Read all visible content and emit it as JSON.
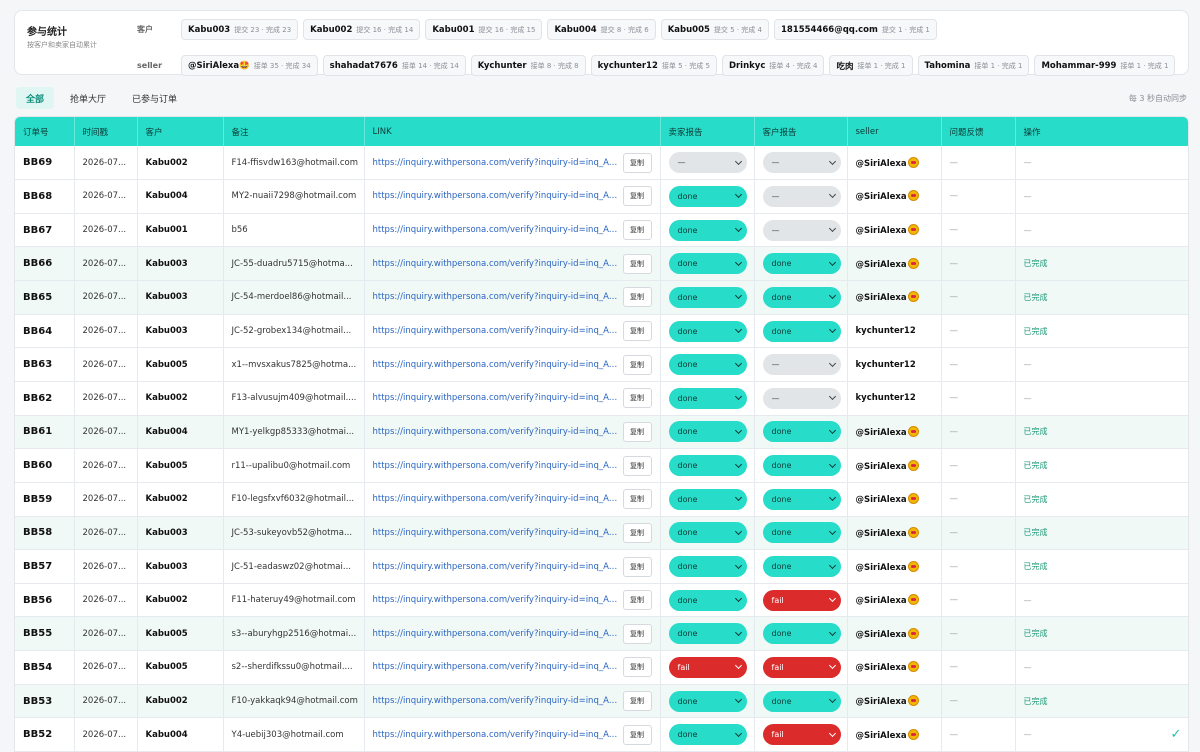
{
  "stats": {
    "title": "参与统计",
    "subtitle": "按客户和卖家自动累计",
    "customer_label": "客户",
    "seller_label": "seller",
    "customers": [
      {
        "name": "Kabu003",
        "meta": "提交 23 · 完成 23"
      },
      {
        "name": "Kabu002",
        "meta": "提交 16 · 完成 14"
      },
      {
        "name": "Kabu001",
        "meta": "提交 16 · 完成 15"
      },
      {
        "name": "Kabu004",
        "meta": "提交 8 · 完成 6"
      },
      {
        "name": "Kabu005",
        "meta": "提交 5 · 完成 4"
      },
      {
        "name": "181554466@qq.com",
        "meta": "提交 1 · 完成 1"
      }
    ],
    "sellers": [
      {
        "name": "@SiriAlexa🤩",
        "meta": "接单 35 · 完成 34"
      },
      {
        "name": "shahadat7676",
        "meta": "接单 14 · 完成 14"
      },
      {
        "name": "Kychunter",
        "meta": "接单 8 · 完成 8"
      },
      {
        "name": "kychunter12",
        "meta": "接单 5 · 完成 5"
      },
      {
        "name": "Drinkyc",
        "meta": "接单 4 · 完成 4"
      },
      {
        "name": "吃肉",
        "meta": "接单 1 · 完成 1"
      },
      {
        "name": "Tahomina",
        "meta": "接单 1 · 完成 1"
      },
      {
        "name": "Mohammar-999",
        "meta": "接单 1 · 完成 1"
      }
    ]
  },
  "tabs": [
    "全部",
    "抢单大厅",
    "已参与订单"
  ],
  "sync_note": "每 3 秒自动同步",
  "table": {
    "headers": [
      "订单号",
      "时间戳",
      "客户",
      "备注",
      "LINK",
      "卖家报告",
      "客户报告",
      "seller",
      "问题反馈",
      "操作"
    ],
    "copy_label": "复制",
    "rows": [
      {
        "order": "BB69",
        "time": "2026-07...",
        "customer": "Kabu002",
        "note": "F14-ffisvdw163@hotmail.com",
        "link": "https://inquiry.withpersona.com/verify?inquiry-id=inq_Aq...",
        "seller_report": "—",
        "customer_report": "—",
        "seller": "@SiriAlexa",
        "feedback": "—",
        "action": "—"
      },
      {
        "order": "BB68",
        "time": "2026-07...",
        "customer": "Kabu004",
        "note": "MY2-nuaii7298@hotmail.com",
        "link": "https://inquiry.withpersona.com/verify?inquiry-id=inq_Aq...",
        "seller_report": "done",
        "customer_report": "—",
        "seller": "@SiriAlexa",
        "feedback": "—",
        "action": "—"
      },
      {
        "order": "BB67",
        "time": "2026-07...",
        "customer": "Kabu001",
        "note": "b56",
        "link": "https://inquiry.withpersona.com/verify?inquiry-id=inq_Aq...",
        "seller_report": "done",
        "customer_report": "—",
        "seller": "@SiriAlexa",
        "feedback": "—",
        "action": "—"
      },
      {
        "order": "BB66",
        "time": "2026-07...",
        "customer": "Kabu003",
        "note": "JC-55-duadru5715@hotma...",
        "link": "https://inquiry.withpersona.com/verify?inquiry-id=inq_Aq...",
        "seller_report": "done",
        "customer_report": "done",
        "seller": "@SiriAlexa",
        "feedback": "—",
        "action": "已完成"
      },
      {
        "order": "BB65",
        "time": "2026-07...",
        "customer": "Kabu003",
        "note": "JC-54-merdoel86@hotmail...",
        "link": "https://inquiry.withpersona.com/verify?inquiry-id=inq_Aq...",
        "seller_report": "done",
        "customer_report": "done",
        "seller": "@SiriAlexa",
        "feedback": "—",
        "action": "已完成"
      },
      {
        "order": "BB64",
        "time": "2026-07...",
        "customer": "Kabu003",
        "note": "JC-52-grobex134@hotmail...",
        "link": "https://inquiry.withpersona.com/verify?inquiry-id=inq_Aq...",
        "seller_report": "done",
        "customer_report": "done",
        "seller": "kychunter12",
        "feedback": "—",
        "action": "已完成"
      },
      {
        "order": "BB63",
        "time": "2026-07...",
        "customer": "Kabu005",
        "note": "x1--mvsxakus7825@hotma...",
        "link": "https://inquiry.withpersona.com/verify?inquiry-id=inq_Aq...",
        "seller_report": "done",
        "customer_report": "—",
        "seller": "kychunter12",
        "feedback": "—",
        "action": "—"
      },
      {
        "order": "BB62",
        "time": "2026-07...",
        "customer": "Kabu002",
        "note": "F13-alvusujm409@hotmail....",
        "link": "https://inquiry.withpersona.com/verify?inquiry-id=inq_Aq...",
        "seller_report": "done",
        "customer_report": "—",
        "seller": "kychunter12",
        "feedback": "—",
        "action": "—"
      },
      {
        "order": "BB61",
        "time": "2026-07...",
        "customer": "Kabu004",
        "note": "MY1-yelkgp85333@hotmai...",
        "link": "https://inquiry.withpersona.com/verify?inquiry-id=inq_Aq...",
        "seller_report": "done",
        "customer_report": "done",
        "seller": "@SiriAlexa",
        "feedback": "—",
        "action": "已完成"
      },
      {
        "order": "BB60",
        "time": "2026-07...",
        "customer": "Kabu005",
        "note": "r11--upalibu0@hotmail.com",
        "link": "https://inquiry.withpersona.com/verify?inquiry-id=inq_Aq...",
        "seller_report": "done",
        "customer_report": "done",
        "seller": "@SiriAlexa",
        "feedback": "—",
        "action": "已完成"
      },
      {
        "order": "BB59",
        "time": "2026-07...",
        "customer": "Kabu002",
        "note": "F10-legsfxvf6032@hotmail...",
        "link": "https://inquiry.withpersona.com/verify?inquiry-id=inq_Aq...",
        "seller_report": "done",
        "customer_report": "done",
        "seller": "@SiriAlexa",
        "feedback": "—",
        "action": "已完成"
      },
      {
        "order": "BB58",
        "time": "2026-07...",
        "customer": "Kabu003",
        "note": "JC-53-sukeyovb52@hotma...",
        "link": "https://inquiry.withpersona.com/verify?inquiry-id=inq_Aq...",
        "seller_report": "done",
        "customer_report": "done",
        "seller": "@SiriAlexa",
        "feedback": "—",
        "action": "已完成"
      },
      {
        "order": "BB57",
        "time": "2026-07...",
        "customer": "Kabu003",
        "note": "JC-51-eadaswz02@hotmai...",
        "link": "https://inquiry.withpersona.com/verify?inquiry-id=inq_Aq...",
        "seller_report": "done",
        "customer_report": "done",
        "seller": "@SiriAlexa",
        "feedback": "—",
        "action": "已完成"
      },
      {
        "order": "BB56",
        "time": "2026-07...",
        "customer": "Kabu002",
        "note": "F11-hateruy49@hotmail.com",
        "link": "https://inquiry.withpersona.com/verify?inquiry-id=inq_Aq...",
        "seller_report": "done",
        "customer_report": "fail",
        "seller": "@SiriAlexa",
        "feedback": "—",
        "action": "—"
      },
      {
        "order": "BB55",
        "time": "2026-07...",
        "customer": "Kabu005",
        "note": "s3--aburyhgp2516@hotmai...",
        "link": "https://inquiry.withpersona.com/verify?inquiry-id=inq_Aq...",
        "seller_report": "done",
        "customer_report": "done",
        "seller": "@SiriAlexa",
        "feedback": "—",
        "action": "已完成"
      },
      {
        "order": "BB54",
        "time": "2026-07...",
        "customer": "Kabu005",
        "note": "s2--sherdifkssu0@hotmail....",
        "link": "https://inquiry.withpersona.com/verify?inquiry-id=inq_Aq...",
        "seller_report": "fail",
        "customer_report": "fail",
        "seller": "@SiriAlexa",
        "feedback": "—",
        "action": "—"
      },
      {
        "order": "BB53",
        "time": "2026-07...",
        "customer": "Kabu002",
        "note": "F10-yakkaqk94@hotmail.com",
        "link": "https://inquiry.withpersona.com/verify?inquiry-id=inq_Aq...",
        "seller_report": "done",
        "customer_report": "done",
        "seller": "@SiriAlexa",
        "feedback": "—",
        "action": "已完成"
      },
      {
        "order": "BB52",
        "time": "2026-07...",
        "customer": "Kabu004",
        "note": "Y4-uebij303@hotmail.com",
        "link": "https://inquiry.withpersona.com/verify?inquiry-id=inq_Aq...",
        "seller_report": "done",
        "customer_report": "fail",
        "seller": "@SiriAlexa",
        "feedback": "—",
        "action": "—"
      }
    ]
  },
  "colors": {
    "accent": "#27dcc9",
    "fail": "#dc2b2b",
    "link": "#2a64c0",
    "done_text": "#1f9a77"
  },
  "icons": {
    "corner_logo": "tick-logo-icon",
    "emoji": "star-struck-emoji-icon"
  }
}
